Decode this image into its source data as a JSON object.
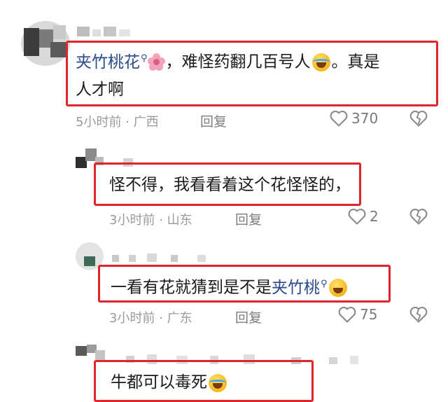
{
  "comments": [
    {
      "mention": "夹竹桃花",
      "text_after": "，难怪药翻几百号人",
      "text_tail": "。真是",
      "line2": "人才啊",
      "time": "5小时前",
      "region": "广西",
      "reply_label": "回复",
      "likes": "370"
    },
    {
      "text": "怪不得，我看看着这个花怪怪的，",
      "time": "3小时前",
      "region": "山东",
      "reply_label": "回复",
      "likes": "2"
    },
    {
      "text_before": "一看有花就猜到是不是",
      "mention": "夹竹桃",
      "time": "3小时前",
      "region": "广东",
      "reply_label": "回复",
      "likes": "75"
    },
    {
      "text": "牛都可以毒死"
    }
  ],
  "meta_separator": "·",
  "icons": {
    "like": "heart-outline-icon",
    "dislike": "broken-heart-icon",
    "search": "search-mini-icon",
    "flower": "cherry-blossom-emoji",
    "laugh_cry": "tears-of-joy-emoji",
    "grin_sweat": "grinning-sweat-emoji"
  },
  "colors": {
    "highlight_border": "#e0252b",
    "mention": "#2b4a8c",
    "meta": "#9b9b9b"
  }
}
